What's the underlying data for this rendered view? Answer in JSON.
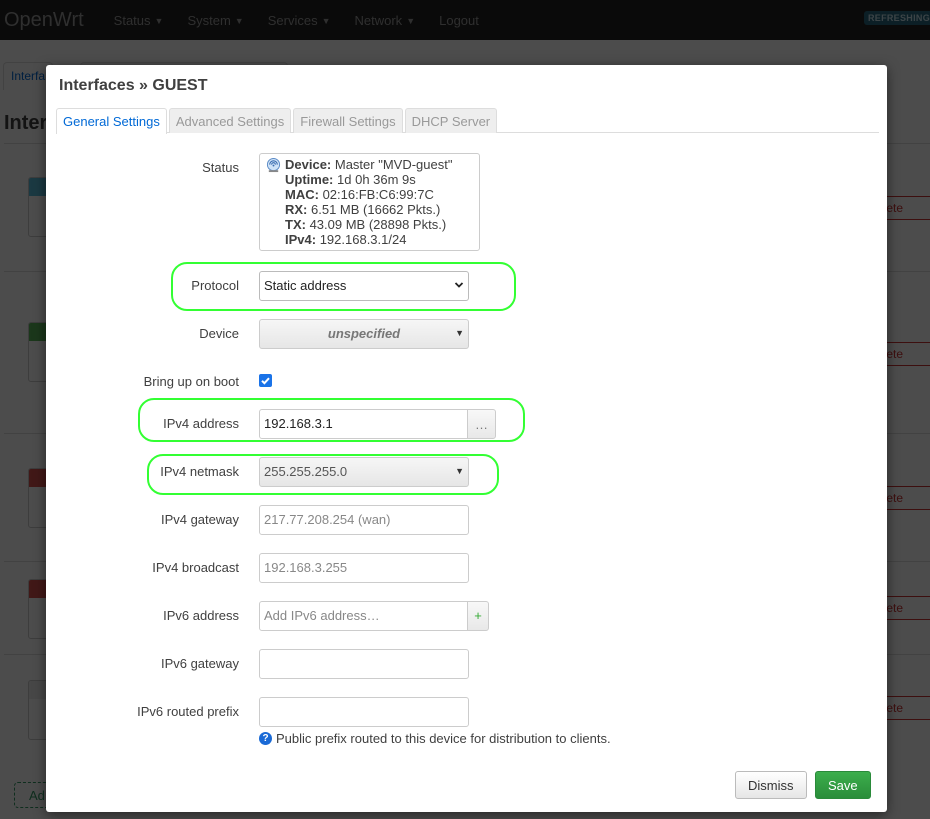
{
  "navbar": {
    "brand": "OpenWrt",
    "menu": [
      {
        "label": "Status",
        "dropdown": true
      },
      {
        "label": "System",
        "dropdown": true
      },
      {
        "label": "Services",
        "dropdown": true
      },
      {
        "label": "Network",
        "dropdown": true
      },
      {
        "label": "Logout",
        "dropdown": false
      }
    ],
    "refresh_badge": "REFRESHING"
  },
  "background_page": {
    "tab_label": "Interfa",
    "heading": "Interf",
    "delete_label": "elete",
    "add_label": "Ad",
    "badge_colors": [
      "#5bc0de",
      "#5cb85c",
      "#d9534f",
      "#d9534f",
      "#eeeeee"
    ]
  },
  "modal": {
    "title": "Interfaces » GUEST",
    "tabs": [
      {
        "label": "General Settings",
        "active": true
      },
      {
        "label": "Advanced Settings",
        "active": false
      },
      {
        "label": "Firewall Settings",
        "active": false
      },
      {
        "label": "DHCP Server",
        "active": false
      }
    ],
    "status": {
      "label": "Status",
      "icon": "wifi-icon",
      "lines": [
        {
          "key": "Device:",
          "value": "Master \"MVD-guest\""
        },
        {
          "key": "Uptime:",
          "value": "1d 0h 36m 9s"
        },
        {
          "key": "MAC:",
          "value": "02:16:FB:C6:99:7C"
        },
        {
          "key": "RX:",
          "value": "6.51 MB (16662 Pkts.)"
        },
        {
          "key": "TX:",
          "value": "43.09 MB (28898 Pkts.)"
        },
        {
          "key": "IPv4:",
          "value": "192.168.3.1/24"
        }
      ]
    },
    "fields": {
      "protocol": {
        "label": "Protocol",
        "value": "Static address"
      },
      "device": {
        "label": "Device",
        "value": "unspecified"
      },
      "boot": {
        "label": "Bring up on boot",
        "checked": true
      },
      "ipv4_address": {
        "label": "IPv4 address",
        "value": "192.168.3.1",
        "addon": "…"
      },
      "ipv4_netmask": {
        "label": "IPv4 netmask",
        "value": "255.255.255.0"
      },
      "ipv4_gateway": {
        "label": "IPv4 gateway",
        "placeholder": "217.77.208.254 (wan)"
      },
      "ipv4_broadcast": {
        "label": "IPv4 broadcast",
        "placeholder": "192.168.3.255"
      },
      "ipv6_address": {
        "label": "IPv6 address",
        "placeholder": "Add IPv6 address…",
        "addon": "+"
      },
      "ipv6_gateway": {
        "label": "IPv6 gateway",
        "value": ""
      },
      "ipv6_prefix": {
        "label": "IPv6 routed prefix",
        "value": "",
        "help": "Public prefix routed to this device for distribution to clients."
      }
    },
    "buttons": {
      "dismiss": "Dismiss",
      "save": "Save"
    }
  }
}
